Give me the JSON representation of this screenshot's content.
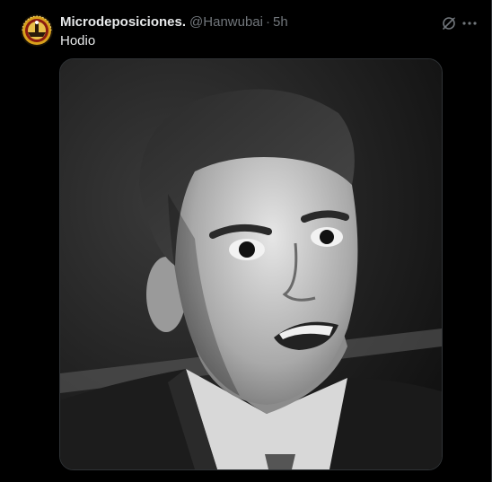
{
  "tweet": {
    "author": {
      "display_name": "Microdeposiciones.",
      "handle": "@Hanwubai",
      "avatar_icon": "avatar-emblem-icon"
    },
    "separator": "·",
    "timestamp": "5h",
    "text": "Hodio",
    "actions": {
      "grok_icon": "grok-icon",
      "more_icon": "more-horizontal-icon"
    },
    "media": {
      "type": "photo",
      "alt": ""
    }
  },
  "colors": {
    "background": "#000000",
    "primary_text": "#e7e9ea",
    "secondary_text": "#71767b",
    "border": "#2f3336"
  }
}
